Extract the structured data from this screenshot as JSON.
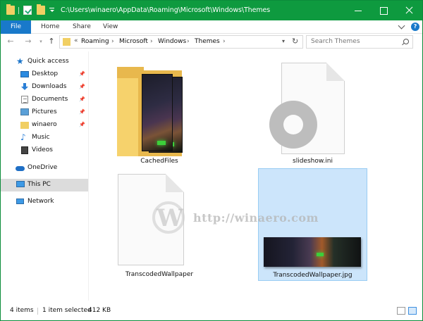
{
  "window": {
    "title": "C:\\Users\\winaero\\AppData\\Roaming\\Microsoft\\Windows\\Themes",
    "accent_color": "#0e9a3f"
  },
  "ribbon": {
    "file_label": "File",
    "tabs": [
      "Home",
      "Share",
      "View"
    ]
  },
  "address": {
    "overflow": "«",
    "crumbs": [
      "Roaming",
      "Microsoft",
      "Windows",
      "Themes"
    ],
    "search_placeholder": "Search Themes"
  },
  "nav": {
    "quick_access": "Quick access",
    "desktop": "Desktop",
    "downloads": "Downloads",
    "documents": "Documents",
    "pictures": "Pictures",
    "winaero": "winaero",
    "music": "Music",
    "videos": "Videos",
    "onedrive": "OneDrive",
    "this_pc": "This PC",
    "network": "Network"
  },
  "files": {
    "cached": "CachedFiles",
    "slideshow": "slideshow.ini",
    "transcoded": "TranscodedWallpaper",
    "transcoded_jpg": "TranscodedWallpaper.jpg"
  },
  "watermark": {
    "letter": "W",
    "text": "http://winaero.com"
  },
  "status": {
    "items": "4 items",
    "selected": "1 item selected",
    "size": "412 KB"
  }
}
